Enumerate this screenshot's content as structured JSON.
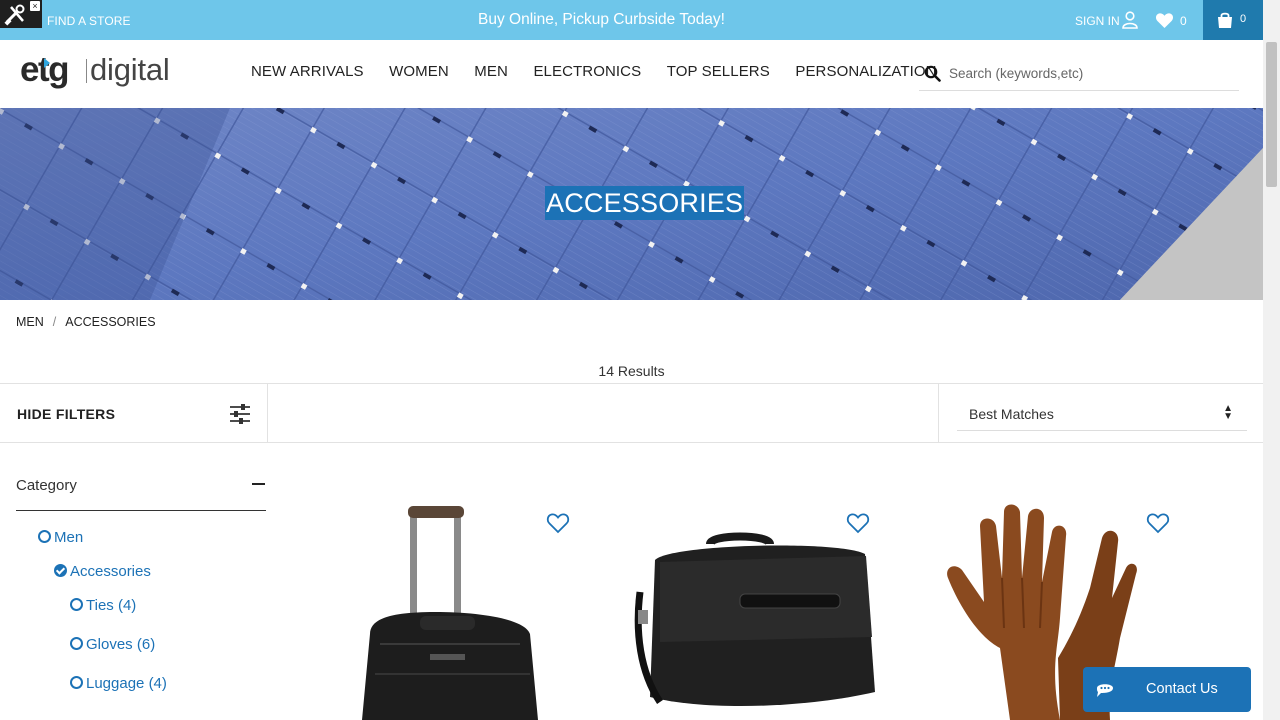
{
  "promo": {
    "find_store": "FIND A STORE",
    "message": "Buy Online, Pickup Curbside Today!",
    "sign_in": "SIGN IN",
    "wishlist_count": "0",
    "cart_count": "0",
    "tools_icon": "tools-icon",
    "color": "#6ec6ea",
    "cart_color": "#1f7aad"
  },
  "header": {
    "logo": {
      "etg": "etg",
      "digital": "digital"
    },
    "nav": [
      "NEW ARRIVALS",
      "WOMEN",
      "MEN",
      "ELECTRONICS",
      "TOP SELLERS",
      "PERSONALIZATION"
    ],
    "search_placeholder": "Search (keywords,etc)"
  },
  "hero": {
    "title": "ACCESSORIES"
  },
  "breadcrumb": {
    "items": [
      "MEN",
      "ACCESSORIES"
    ],
    "separator": "/"
  },
  "results": {
    "label": "14 Results"
  },
  "filters": {
    "hide_label": "HIDE FILTERS",
    "sort_value": "Best Matches"
  },
  "sidebar": {
    "category_title": "Category",
    "items": [
      {
        "label": "Men",
        "checked": false
      },
      {
        "label": "Accessories",
        "checked": true
      },
      {
        "label": "Ties (4)",
        "checked": false
      },
      {
        "label": "Gloves (6)",
        "checked": false
      },
      {
        "label": "Luggage (4)",
        "checked": false
      }
    ]
  },
  "products": [
    {
      "name": "rolling-laptop-bag",
      "icon": "heart-outline-icon"
    },
    {
      "name": "messenger-bag",
      "icon": "heart-outline-icon"
    },
    {
      "name": "suede-gloves",
      "icon": "heart-outline-icon"
    }
  ],
  "contact": {
    "label": "Contact Us",
    "color": "#1c72b6"
  },
  "colors": {
    "accent": "#1c72b6",
    "link": "#1c72b6"
  }
}
